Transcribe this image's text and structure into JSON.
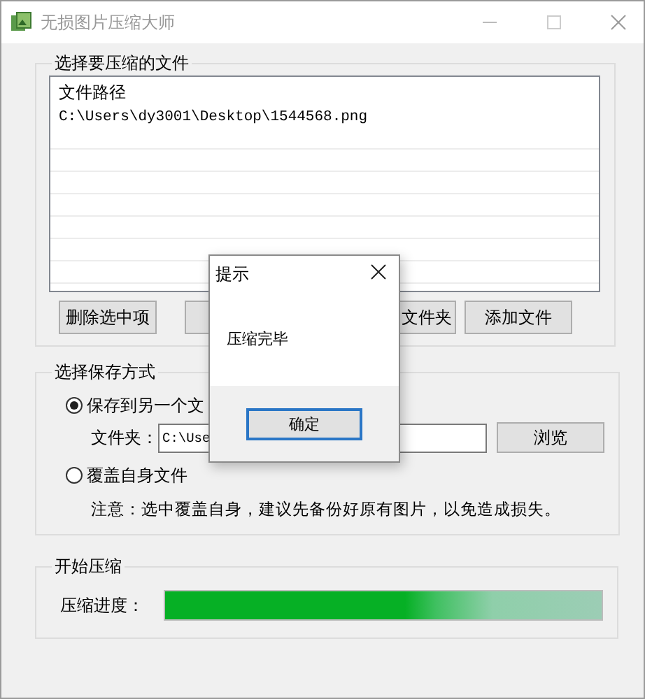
{
  "window": {
    "title": "无损图片压缩大师"
  },
  "file_group": {
    "title": "选择要压缩的文件",
    "list": {
      "header": "文件路径",
      "rows": [
        "C:\\Users\\dy3001\\Desktop\\1544568.png"
      ]
    },
    "buttons": [
      {
        "kind": "full",
        "label": "删除选中项"
      },
      {
        "kind": "covered"
      },
      {
        "kind": "clipped",
        "label": "文件夹"
      },
      {
        "kind": "full",
        "label": "添加文件"
      }
    ]
  },
  "save_group": {
    "title": "选择保存方式",
    "options": [
      {
        "label": "保存到另一个文",
        "selected": true
      },
      {
        "label": "覆盖自身文件",
        "selected": false
      }
    ],
    "folder": {
      "label": "文件夹：",
      "value": "C:\\Use"
    },
    "browse_button": "浏览",
    "note": "注意：选中覆盖自身，建议先备份好原有图片，以免造成损失。"
  },
  "compress_group": {
    "title": "开始压缩",
    "progress": {
      "label": "压缩进度：",
      "level": 1
    }
  },
  "dialog": {
    "title": "提示",
    "message": "压缩完毕",
    "button": "确定"
  }
}
